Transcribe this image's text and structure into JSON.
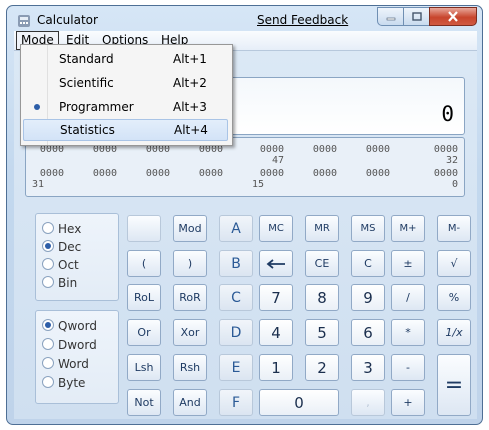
{
  "window": {
    "title": "Calculator",
    "feedback": "Send Feedback"
  },
  "menubar": {
    "mode": "Mode",
    "edit": "Edit",
    "options": "Options",
    "help": "Help"
  },
  "mode_menu": {
    "items": [
      {
        "label": "Standard",
        "shortcut": "Alt+1"
      },
      {
        "label": "Scientific",
        "shortcut": "Alt+2"
      },
      {
        "label": "Programmer",
        "shortcut": "Alt+3"
      },
      {
        "label": "Statistics",
        "shortcut": "Alt+4"
      }
    ]
  },
  "display": {
    "value": "0"
  },
  "bits": {
    "row1": [
      {
        "d": "0000",
        "p": ""
      },
      {
        "d": "0000",
        "p": ""
      },
      {
        "d": "0000",
        "p": ""
      },
      {
        "d": "0000",
        "p": ""
      },
      {
        "d": "0000",
        "p": "47"
      },
      {
        "d": "0000",
        "p": ""
      },
      {
        "d": "0000",
        "p": ""
      },
      {
        "d": "0000",
        "p": "32"
      }
    ],
    "row2": [
      {
        "d": "0000",
        "p": "31"
      },
      {
        "d": "0000",
        "p": ""
      },
      {
        "d": "0000",
        "p": ""
      },
      {
        "d": "0000",
        "p": ""
      },
      {
        "d": "0000",
        "p": "15"
      },
      {
        "d": "0000",
        "p": ""
      },
      {
        "d": "0000",
        "p": ""
      },
      {
        "d": "0000",
        "p": "0"
      }
    ]
  },
  "base": {
    "hex": "Hex",
    "dec": "Dec",
    "oct": "Oct",
    "bin": "Bin"
  },
  "word": {
    "qword": "Qword",
    "dword": "Dword",
    "word": "Word",
    "byte": "Byte"
  },
  "keys": {
    "mod": "Mod",
    "lparen": "(",
    "rparen": ")",
    "rol": "RoL",
    "ror": "RoR",
    "or": "Or",
    "xor": "Xor",
    "lsh": "Lsh",
    "rsh": "Rsh",
    "not": "Not",
    "and": "And",
    "a": "A",
    "b": "B",
    "c": "C",
    "d": "D",
    "e": "E",
    "f": "F",
    "mc": "MC",
    "mr": "MR",
    "ms": "MS",
    "mplus": "M+",
    "mminus": "M-",
    "back": "⟵",
    "ce": "CE",
    "clear": "C",
    "negate": "±",
    "sqrt": "√",
    "n7": "7",
    "n8": "8",
    "n9": "9",
    "div": "/",
    "pct": "%",
    "n4": "4",
    "n5": "5",
    "n6": "6",
    "mul": "*",
    "recip": "1/x",
    "n1": "1",
    "n2": "2",
    "n3": "3",
    "sub": "-",
    "equals": "=",
    "n0": "0",
    "dot": ",",
    "add": "+"
  }
}
